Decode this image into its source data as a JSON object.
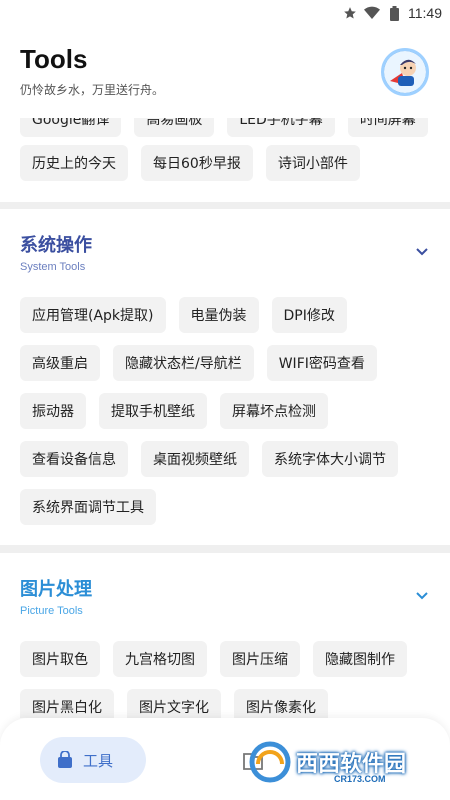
{
  "status_bar": {
    "time": "11:49"
  },
  "header": {
    "title": "Tools",
    "subtitle": "仍怜故乡水，万里送行舟。"
  },
  "top_section": {
    "partial_items": [
      "Google翻译",
      "高易画板",
      "LED手机字幕",
      "时间屏幕"
    ],
    "items": [
      "历史上的今天",
      "每日60秒早报",
      "诗词小部件"
    ]
  },
  "system_section": {
    "title": "系统操作",
    "subtitle": "System Tools",
    "title_color": "#3b4fa0",
    "subtitle_color": "#6b7fbf",
    "rows": [
      [
        "应用管理(Apk提取)",
        "电量伪装",
        "DPI修改"
      ],
      [
        "高级重启",
        "隐藏状态栏/导航栏",
        "WIFI密码查看"
      ],
      [
        "振动器",
        "提取手机壁纸",
        "屏幕坏点检测"
      ],
      [
        "查看设备信息",
        "桌面视频壁纸",
        "系统字体大小调节"
      ],
      [
        "系统界面调节工具"
      ]
    ]
  },
  "picture_section": {
    "title": "图片处理",
    "subtitle": "Picture Tools",
    "title_color": "#2b8ed6",
    "subtitle_color": "#4aa6e6",
    "rows": [
      [
        "图片取色",
        "九宫格切图",
        "图片压缩",
        "隐藏图制作"
      ],
      [
        "图片黑白化",
        "图片文字化",
        "图片像素化"
      ]
    ]
  },
  "bottom_nav": {
    "tools_label": "工具"
  },
  "watermark": {
    "text": "西西软件园",
    "url": "CR173.COM"
  }
}
